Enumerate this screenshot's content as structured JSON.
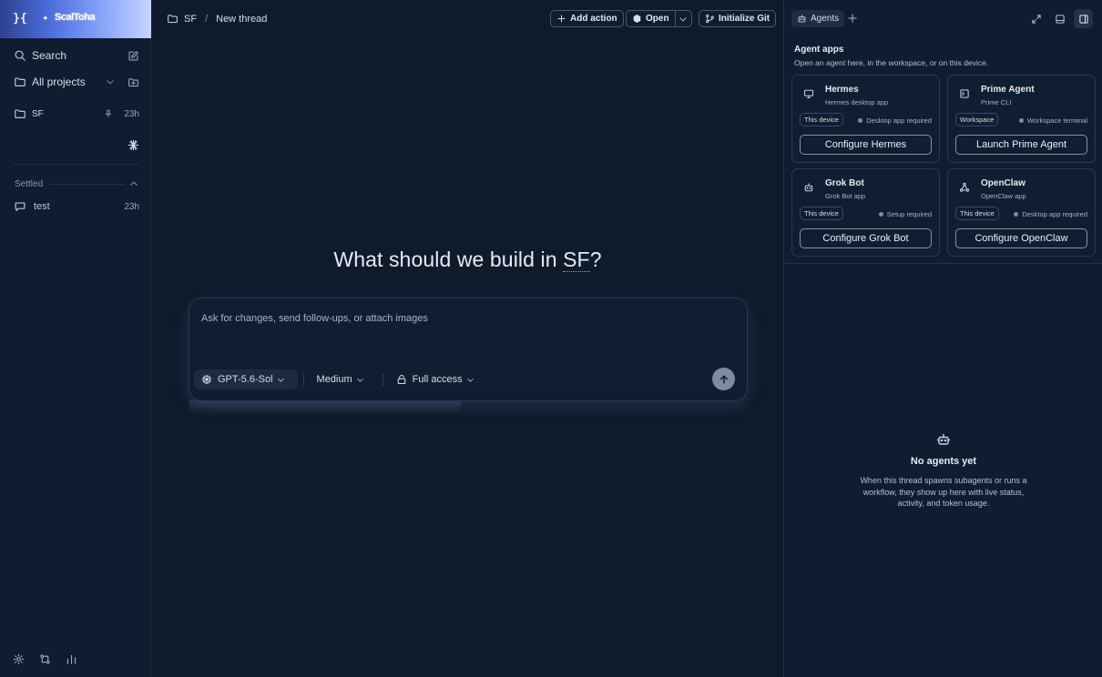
{
  "sidebar": {
    "brand_name": "ScalToha",
    "search_label": "Search",
    "projects_label": "All projects",
    "project": {
      "name": "SF",
      "time": "23h"
    },
    "settled_label": "Settled",
    "thread": {
      "name": "test",
      "time": "23h"
    }
  },
  "topbar": {
    "project": "SF",
    "separator": "/",
    "thread_title": "New thread",
    "add_action": "Add action",
    "open": "Open",
    "initialize_git": "Initialize Git"
  },
  "hero": {
    "prefix": "What should we build in ",
    "project": "SF",
    "suffix": "?"
  },
  "composer": {
    "placeholder": "Ask for changes, send follow-ups, or attach images",
    "model": "GPT-5.6-Sol",
    "effort": "Medium",
    "access": "Full access"
  },
  "panel": {
    "tab": "Agents",
    "title": "Agent apps",
    "subtitle": "Open an agent here, in the workspace, or on this device.",
    "agents": [
      {
        "name": "Hermes",
        "desc": "Hermes desktop app",
        "badge": "This device",
        "status": "Desktop app required",
        "action": "Configure Hermes",
        "icon": "monitor-icon"
      },
      {
        "name": "Prime Agent",
        "desc": "Prime CLI",
        "badge": "Workspace",
        "status": "Workspace terminal",
        "action": "Launch Prime Agent",
        "icon": "terminal-icon"
      },
      {
        "name": "Grok Bot",
        "desc": "Grok Bot app",
        "badge": "This device",
        "status": "Setup required",
        "action": "Configure Grok Bot",
        "icon": "bot-icon"
      },
      {
        "name": "OpenClaw",
        "desc": "OpenClaw app",
        "badge": "This device",
        "status": "Desktop app required",
        "action": "Configure OpenClaw",
        "icon": "network-icon"
      }
    ],
    "empty_title": "No agents yet",
    "empty_text": "When this thread spawns subagents or runs a workflow, they show up here with live status, activity, and token usage."
  },
  "colors": {
    "background": "#0f1a2b",
    "sidebar": "#101c30",
    "accent": "#4566d6",
    "send_button": "#7d8ba3"
  }
}
